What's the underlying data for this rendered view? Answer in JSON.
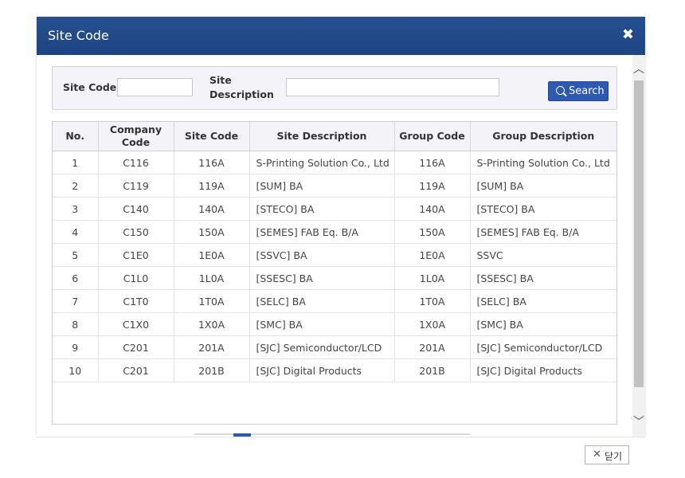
{
  "dialog": {
    "title": "Site Code",
    "close_icon": "close-icon"
  },
  "search": {
    "site_code_label": "Site Code",
    "site_code_value": "",
    "site_desc_label_line1": "Site",
    "site_desc_label_line2": "Description",
    "site_desc_value": "",
    "search_button": "Search"
  },
  "table": {
    "headers": {
      "no": "No.",
      "company_code_line1": "Company",
      "company_code_line2": "Code",
      "site_code": "Site Code",
      "site_description": "Site Description",
      "group_code": "Group Code",
      "group_description": "Group Description"
    },
    "rows": [
      {
        "no": "1",
        "company": "C116",
        "site": "116A",
        "site_desc": "S-Printing Solution Co., Ltd",
        "group": "116A",
        "group_desc": "S-Printing Solution Co., Ltd"
      },
      {
        "no": "2",
        "company": "C119",
        "site": "119A",
        "site_desc": "[SUM] BA",
        "group": "119A",
        "group_desc": "[SUM] BA"
      },
      {
        "no": "3",
        "company": "C140",
        "site": "140A",
        "site_desc": "[STECO] BA",
        "group": "140A",
        "group_desc": "[STECO] BA"
      },
      {
        "no": "4",
        "company": "C150",
        "site": "150A",
        "site_desc": "[SEMES] FAB Eq. B/A",
        "group": "150A",
        "group_desc": "[SEMES] FAB Eq. B/A"
      },
      {
        "no": "5",
        "company": "C1E0",
        "site": "1E0A",
        "site_desc": "[SSVC] BA",
        "group": "1E0A",
        "group_desc": "SSVC"
      },
      {
        "no": "6",
        "company": "C1L0",
        "site": "1L0A",
        "site_desc": "[SSESC] BA",
        "group": "1L0A",
        "group_desc": "[SSESC] BA"
      },
      {
        "no": "7",
        "company": "C1T0",
        "site": "1T0A",
        "site_desc": "[SELC] BA",
        "group": "1T0A",
        "group_desc": "[SELC] BA"
      },
      {
        "no": "8",
        "company": "C1X0",
        "site": "1X0A",
        "site_desc": "[SMC] BA",
        "group": "1X0A",
        "group_desc": "[SMC] BA"
      },
      {
        "no": "9",
        "company": "C201",
        "site": "201A",
        "site_desc": "[SJC] Semiconductor/LCD",
        "group": "201A",
        "group_desc": "[SJC] Semiconductor/LCD"
      },
      {
        "no": "10",
        "company": "C201",
        "site": "201B",
        "site_desc": "[SJC] Digital Products",
        "group": "201B",
        "group_desc": "[SJC] Digital Products"
      }
    ]
  },
  "scrollbar": {
    "up_icon": "chevron-up-icon",
    "down_icon": "chevron-down-icon"
  },
  "footer": {
    "close_label": "닫기",
    "close_icon": "x-icon"
  },
  "colors": {
    "titlebar": "#1e4483",
    "search_button": "#2d5ab0",
    "header_bg": "#f3f3f8"
  }
}
